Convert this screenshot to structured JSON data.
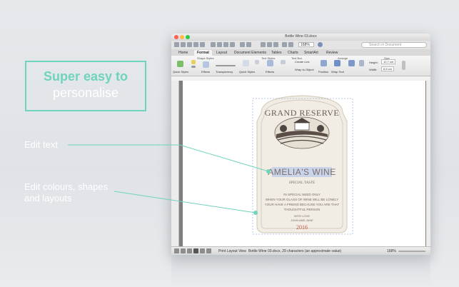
{
  "promo": {
    "title": "Super easy to",
    "subtitle": "personalise"
  },
  "callouts": {
    "edit_text": "Edit text",
    "edit_colours_line1": "Edit colours, shapes",
    "edit_colours_line2": "and layouts"
  },
  "window": {
    "title": "Bottle Wine 03.docx",
    "zoom": "168%",
    "search_placeholder": "Search in Document",
    "tabs": [
      "Home",
      "Format",
      "Layout",
      "Document Elements",
      "Tables",
      "Charts",
      "SmartArt",
      "Review"
    ],
    "active_tab": "Format",
    "ribbon_groups": {
      "shape_styles": "Shape Styles",
      "text_styles": "Text Styles",
      "text_box": "Text Box",
      "arrange": "Arrange",
      "size": "Size"
    },
    "ribbon_labels": {
      "quick_styles": "Quick Styles",
      "effects": "Effects",
      "transparency": "Transparency",
      "quick_styles_2": "Quick Styles",
      "effects_2": "Effects",
      "create_link": "Create Link",
      "wrap_to_object": "Wrap to Object",
      "position": "Position",
      "wrap_text": "Wrap Text",
      "height_label": "Height:",
      "height_value": "10,7 cm",
      "width_label": "Width:",
      "width_value": "6,8 cm"
    },
    "status": {
      "view": "Print Layout View",
      "doc_info": "Bottle Wine 03.docx, 29 characters (an approximate value)",
      "zoom": "168%"
    }
  },
  "label": {
    "grand_reserve": "GRAND RESERVE",
    "name": "AMELIA'S WINE",
    "special_taste": "SPECIAL TASTE",
    "line1": "IN SPECIAL NEED ONLY",
    "line2": "WHEN YOUR GLASS OF WINE WILL BE LONELY",
    "line3": "YOUR HAVE A FRIEND BECAUSE YOU ARE THAT",
    "line4": "THOUGHTFUL PERSON",
    "line5": "WITH LOVE",
    "line6": "JOHN AND JANE",
    "year": "2016"
  },
  "colors": {
    "accent": "#6fd3be",
    "label_bg": "#f1ede4",
    "label_text": "#7b6a5e",
    "selection": "#c9d3ea"
  }
}
